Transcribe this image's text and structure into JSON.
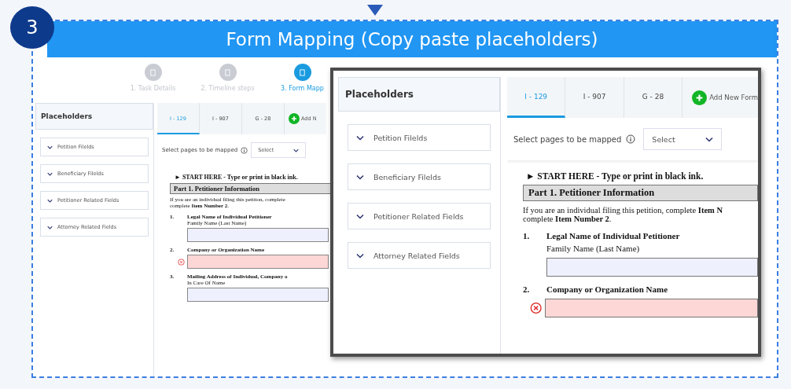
{
  "step_badge": "3",
  "banner": {
    "title": "Form Mapping (Copy paste placeholders)"
  },
  "background_screen": {
    "stepper": [
      {
        "label": "1. Task Details",
        "selected": false
      },
      {
        "label": "2. Timeline steps",
        "selected": false
      },
      {
        "label": "3. Form Mapp",
        "selected": true
      }
    ],
    "placeholders": {
      "title": "Placeholders",
      "items": [
        "Petition Filelds",
        "Beneficiary Filelds",
        "Petitioner Related Fields",
        "Attorney Related Fields"
      ]
    },
    "tabs": [
      {
        "label": "I - 129",
        "selected": true
      },
      {
        "label": "I - 907",
        "selected": false
      },
      {
        "label": "G - 28",
        "selected": false
      }
    ],
    "add_form": "Add N",
    "page_select": {
      "label": "Select pages to be mapped",
      "placeholder": "Select"
    },
    "form": {
      "start": "► START HERE - Type or print in black ink.",
      "part": "Part 1.   Petitioner Information",
      "intro_lines": [
        "If you are an individual filing this petition, complete",
        "complete **Item Number 2**."
      ],
      "questions": [
        {
          "number": "1.",
          "title": "Legal Name of Individual Petitioner",
          "field_label": "Family Name (Last Name)",
          "error": false
        },
        {
          "number": "2.",
          "title": "Company or Organization Name",
          "error": true
        },
        {
          "number": "3.",
          "title": "Mailing Address of Individual, Company o",
          "field_label": "In Care Of Name",
          "error": false
        }
      ]
    }
  },
  "zoomed_view": {
    "placeholders": {
      "title": "Placeholders",
      "items": [
        "Petition Filelds",
        "Beneficiary Filelds",
        "Petitioner Related Fields",
        "Attorney Related Fields"
      ]
    },
    "tabs": [
      {
        "label": "I - 129",
        "selected": true
      },
      {
        "label": "I - 907",
        "selected": false
      },
      {
        "label": "G - 28",
        "selected": false
      }
    ],
    "add_form": "Add New Form",
    "page_select": {
      "label": "Select pages to be mapped",
      "placeholder": "Select"
    },
    "form": {
      "start": "► START HERE - Type or print in black ink.",
      "part": "Part 1.   Petitioner Information",
      "intro_lines": [
        "If you are an individual filing this petition, complete **Item N**",
        "complete **Item Number 2**."
      ],
      "questions": [
        {
          "number": "1.",
          "title": "Legal Name of Individual Petitioner",
          "field_label": "Family Name (Last Name)",
          "error": false
        },
        {
          "number": "2.",
          "title": "Company or Organization Name",
          "error": true
        }
      ]
    }
  }
}
